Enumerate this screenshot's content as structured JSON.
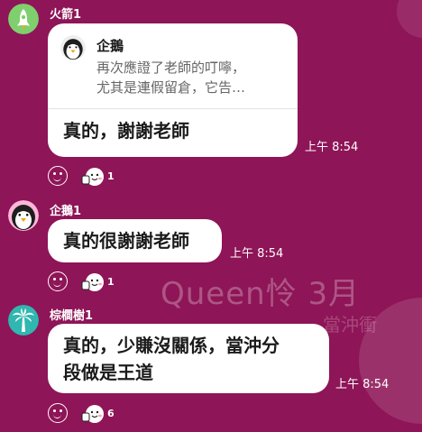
{
  "colors": {
    "background": "#8e1557",
    "bubble": "#ffffff",
    "text": "#1b1b1b",
    "quote_text": "#666666",
    "meta_text": "#ffffff"
  },
  "watermark": {
    "line1": "Queen怜  3月",
    "line2": "當沖衝"
  },
  "messages": [
    {
      "sender": "火箭1",
      "avatar_icon": "rocket-icon",
      "quote": {
        "author": "企鵝",
        "avatar_icon": "penguin-icon",
        "lines": [
          "再次應證了老師的叮嚀，",
          "尤其是連假留倉，它告…"
        ]
      },
      "text_lines": [
        "真的，謝謝老師"
      ],
      "time": "上午 8:54",
      "reaction_count": "1"
    },
    {
      "sender": "企鵝1",
      "avatar_icon": "penguin-icon",
      "text_lines": [
        "真的很謝謝老師"
      ],
      "time": "上午 8:54",
      "reaction_count": "1"
    },
    {
      "sender": "棕櫚樹1",
      "avatar_icon": "palm-tree-icon",
      "text_lines": [
        "真的，少賺沒關係，當沖分",
        "段做是王道"
      ],
      "time": "上午 8:54",
      "reaction_count": "6"
    }
  ]
}
